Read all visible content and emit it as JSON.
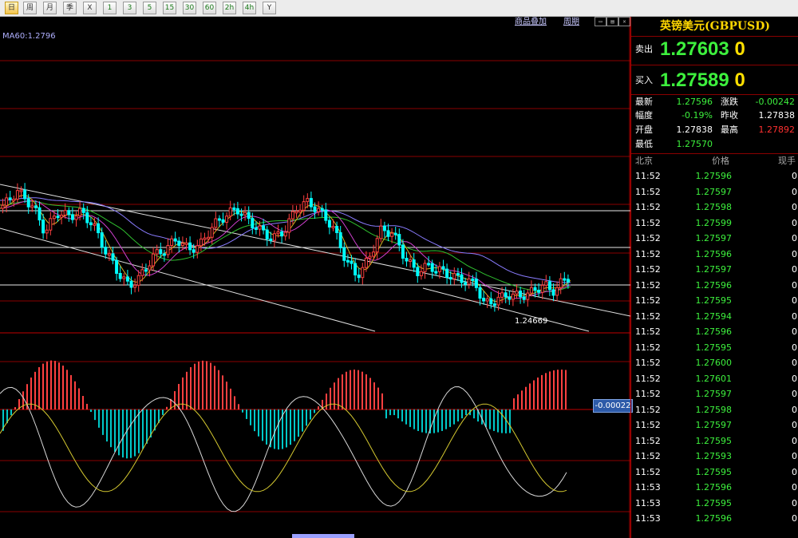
{
  "toolbar": {
    "buttons": [
      "日",
      "周",
      "月",
      "季",
      "X",
      "1",
      "3",
      "5",
      "15",
      "30",
      "60",
      "2h",
      "4h",
      "Y"
    ]
  },
  "chart_header": {
    "overlay_link": "商品叠加",
    "period_link": "周期",
    "ma_label": "MA60:1.2796"
  },
  "chart_data": {
    "type": "candlestick",
    "indicators": [
      "MA",
      "MACD"
    ],
    "price_annotation": "1.24669",
    "macd_value_badge": "-0.00022"
  },
  "colors": {
    "up": "#ff4040",
    "down": "#00ffff",
    "bid_ask": "#3df03d",
    "title": "#ffd700",
    "grid": "#8a0000",
    "macd_dif": "#d8d8d8",
    "macd_dea": "#d4c830"
  },
  "panel": {
    "title": "英镑美元(GBPUSD)",
    "sell_label": "卖出",
    "sell_price": "1.27603",
    "sell_suffix": "0",
    "buy_label": "买入",
    "buy_price": "1.27589",
    "buy_suffix": "0",
    "stats": {
      "latest_label": "最新",
      "latest": "1.27596",
      "change_label": "涨跌",
      "change": "-0.00242",
      "range_label": "幅度",
      "range": "-0.19%",
      "prev_close_label": "昨收",
      "prev_close": "1.27838",
      "open_label": "开盘",
      "open": "1.27838",
      "high_label": "最高",
      "high": "1.27892",
      "low_label": "最低",
      "low": "1.27570"
    },
    "ticks_header": {
      "time": "北京",
      "price": "价格",
      "volume": "现手"
    },
    "ticks": [
      {
        "time": "11:52",
        "price": "1.27596",
        "volume": "0"
      },
      {
        "time": "11:52",
        "price": "1.27597",
        "volume": "0"
      },
      {
        "time": "11:52",
        "price": "1.27598",
        "volume": "0"
      },
      {
        "time": "11:52",
        "price": "1.27599",
        "volume": "0"
      },
      {
        "time": "11:52",
        "price": "1.27597",
        "volume": "0"
      },
      {
        "time": "11:52",
        "price": "1.27596",
        "volume": "0"
      },
      {
        "time": "11:52",
        "price": "1.27597",
        "volume": "0"
      },
      {
        "time": "11:52",
        "price": "1.27596",
        "volume": "0"
      },
      {
        "time": "11:52",
        "price": "1.27595",
        "volume": "0"
      },
      {
        "time": "11:52",
        "price": "1.27594",
        "volume": "0"
      },
      {
        "time": "11:52",
        "price": "1.27596",
        "volume": "0"
      },
      {
        "time": "11:52",
        "price": "1.27595",
        "volume": "0"
      },
      {
        "time": "11:52",
        "price": "1.27600",
        "volume": "0"
      },
      {
        "time": "11:52",
        "price": "1.27601",
        "volume": "0"
      },
      {
        "time": "11:52",
        "price": "1.27597",
        "volume": "0"
      },
      {
        "time": "11:52",
        "price": "1.27598",
        "volume": "0"
      },
      {
        "time": "11:52",
        "price": "1.27597",
        "volume": "0"
      },
      {
        "time": "11:52",
        "price": "1.27595",
        "volume": "0"
      },
      {
        "time": "11:52",
        "price": "1.27593",
        "volume": "0"
      },
      {
        "time": "11:52",
        "price": "1.27595",
        "volume": "0"
      },
      {
        "time": "11:53",
        "price": "1.27596",
        "volume": "0"
      },
      {
        "time": "11:53",
        "price": "1.27595",
        "volume": "0"
      },
      {
        "time": "11:53",
        "price": "1.27596",
        "volume": "0"
      }
    ]
  }
}
